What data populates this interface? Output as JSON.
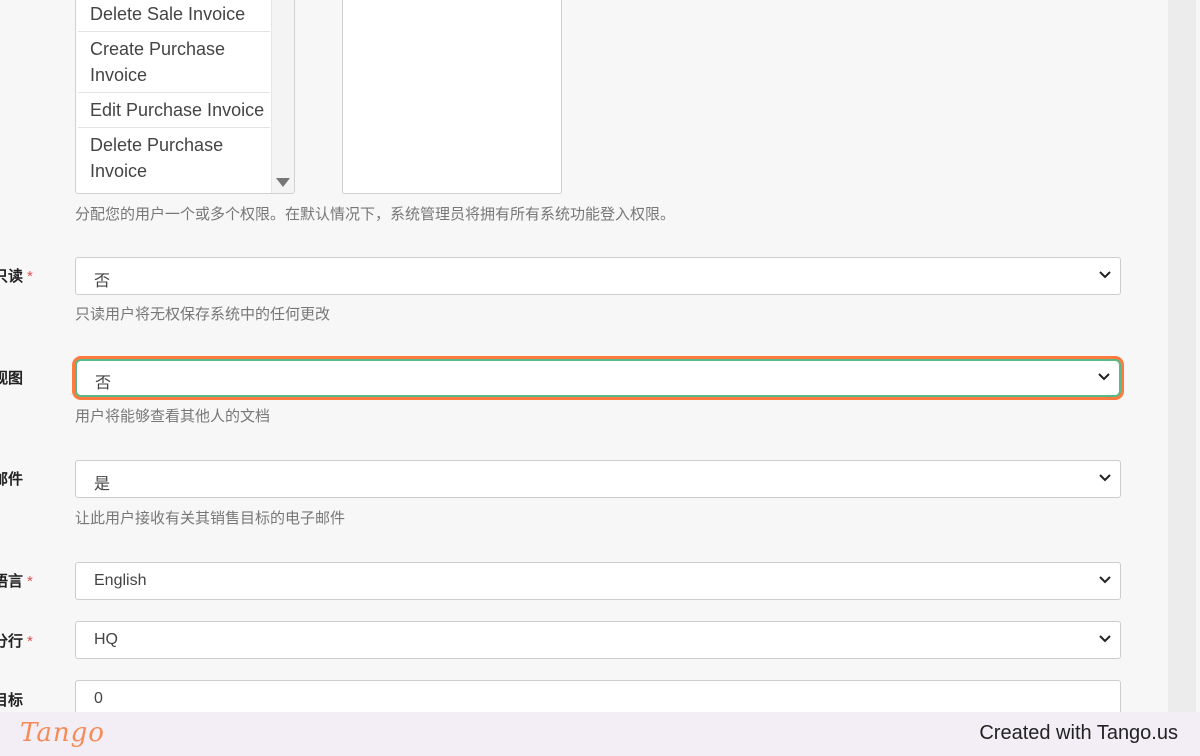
{
  "permissions": {
    "items": [
      "Delete Sale Invoice",
      "Create Purchase Invoice",
      "Edit Purchase Invoice",
      "Delete Purchase Invoice"
    ],
    "help": "分配您的用户一个或多个权限。在默认情况下，系统管理员将拥有所有系统功能登入权限。"
  },
  "fields": {
    "readonly": {
      "label": "只读",
      "required": "*",
      "value": "否",
      "help": "只读用户将无权保存系统中的任何更改"
    },
    "view": {
      "label": "视图",
      "value": "否",
      "help": "用户将能够查看其他人的文档"
    },
    "email": {
      "label": "邮件",
      "value": "是",
      "help": "让此用户接收有关其销售目标的电子邮件"
    },
    "language": {
      "label": "语言",
      "required": "*",
      "value": "English"
    },
    "branch": {
      "label": "分行",
      "required": "*",
      "value": "HQ"
    },
    "target": {
      "label": "目标",
      "value": "0"
    }
  },
  "footer": {
    "logo": "Tango",
    "credit": "Created with Tango.us"
  }
}
